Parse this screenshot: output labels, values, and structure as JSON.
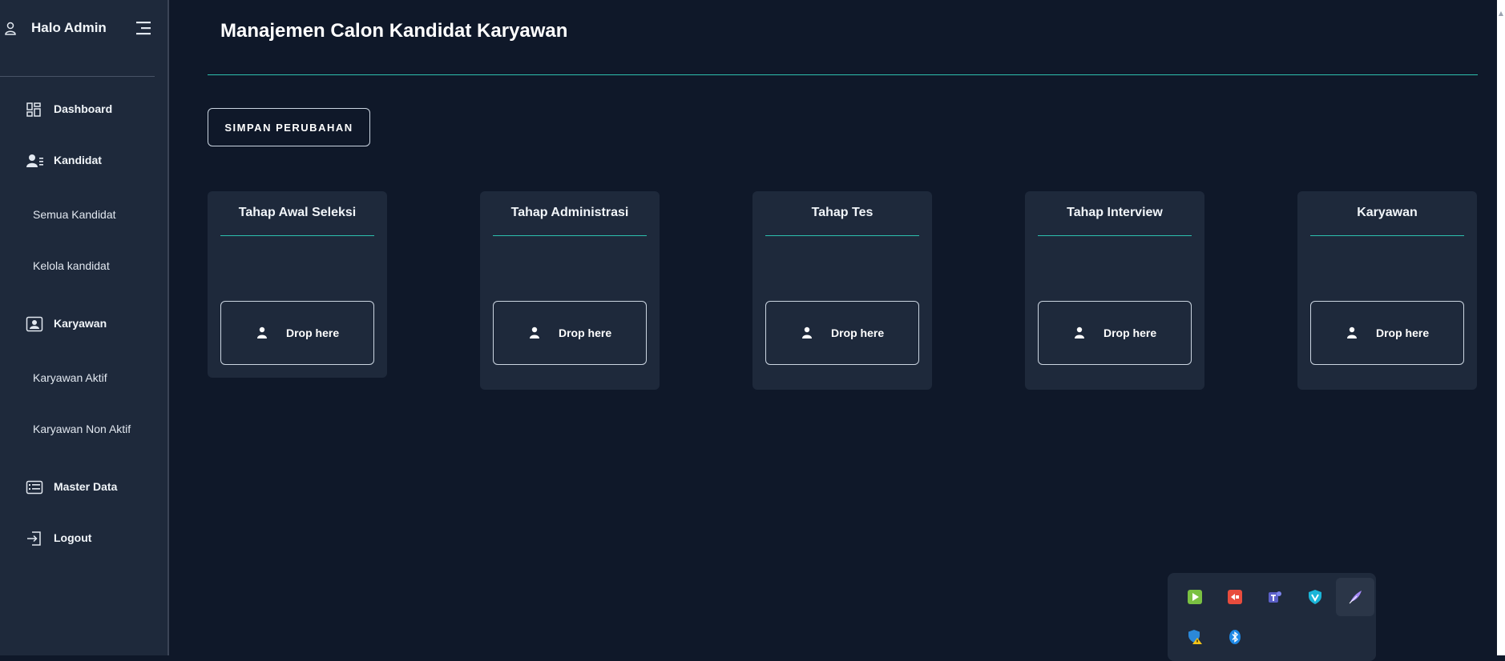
{
  "sidebar": {
    "title": "Halo Admin",
    "nav": {
      "dashboard": "Dashboard",
      "kandidat": "Kandidat",
      "semua_kandidat": "Semua Kandidat",
      "kelola_kandidat": "Kelola kandidat",
      "karyawan": "Karyawan",
      "karyawan_aktif": "Karyawan Aktif",
      "karyawan_non_aktif": "Karyawan Non Aktif",
      "master_data": "Master Data",
      "logout": "Logout"
    }
  },
  "main": {
    "title": "Manajemen Calon Kandidat Karyawan",
    "save_button": "SIMPAN PERUBAHAN",
    "stages": [
      {
        "title": "Tahap Awal Seleksi",
        "drop_label": "Drop here"
      },
      {
        "title": "Tahap Administrasi",
        "drop_label": "Drop here"
      },
      {
        "title": "Tahap Tes",
        "drop_label": "Drop here"
      },
      {
        "title": "Tahap Interview",
        "drop_label": "Drop here"
      },
      {
        "title": "Karyawan",
        "drop_label": "Drop here"
      }
    ]
  },
  "tray": {
    "icons": [
      "media-player-icon",
      "remote-desktop-icon",
      "teams-icon",
      "vpn-shield-icon",
      "feather-icon",
      "security-warning-icon",
      "bluetooth-icon"
    ]
  },
  "colors": {
    "background": "#0f1829",
    "sidebar": "#1e293b",
    "card": "#1e293b",
    "accent": "#2dbfae"
  }
}
